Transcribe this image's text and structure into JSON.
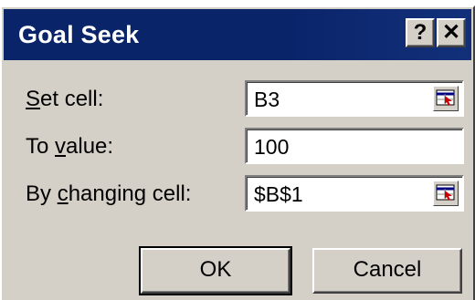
{
  "dialog": {
    "title": "Goal Seek",
    "help_glyph": "?",
    "close_glyph": "✕"
  },
  "fields": {
    "set_cell": {
      "label_accel": "S",
      "label_rest": "et cell:",
      "value": "B3"
    },
    "to_value": {
      "label_pre": "To ",
      "label_accel": "v",
      "label_rest": "alue:",
      "value": "100"
    },
    "changing_cell": {
      "label_pre": "By ",
      "label_accel": "c",
      "label_rest": "hanging cell:",
      "value": "$B$1"
    }
  },
  "buttons": {
    "ok": "OK",
    "cancel": "Cancel"
  },
  "icons": {
    "help": "help-icon",
    "close": "close-icon",
    "range_picker": "collapse-dialog-icon"
  },
  "colors": {
    "titlebar": "#0a246a",
    "face": "#d4d0c8",
    "picker_arrow": "#cc0000"
  }
}
